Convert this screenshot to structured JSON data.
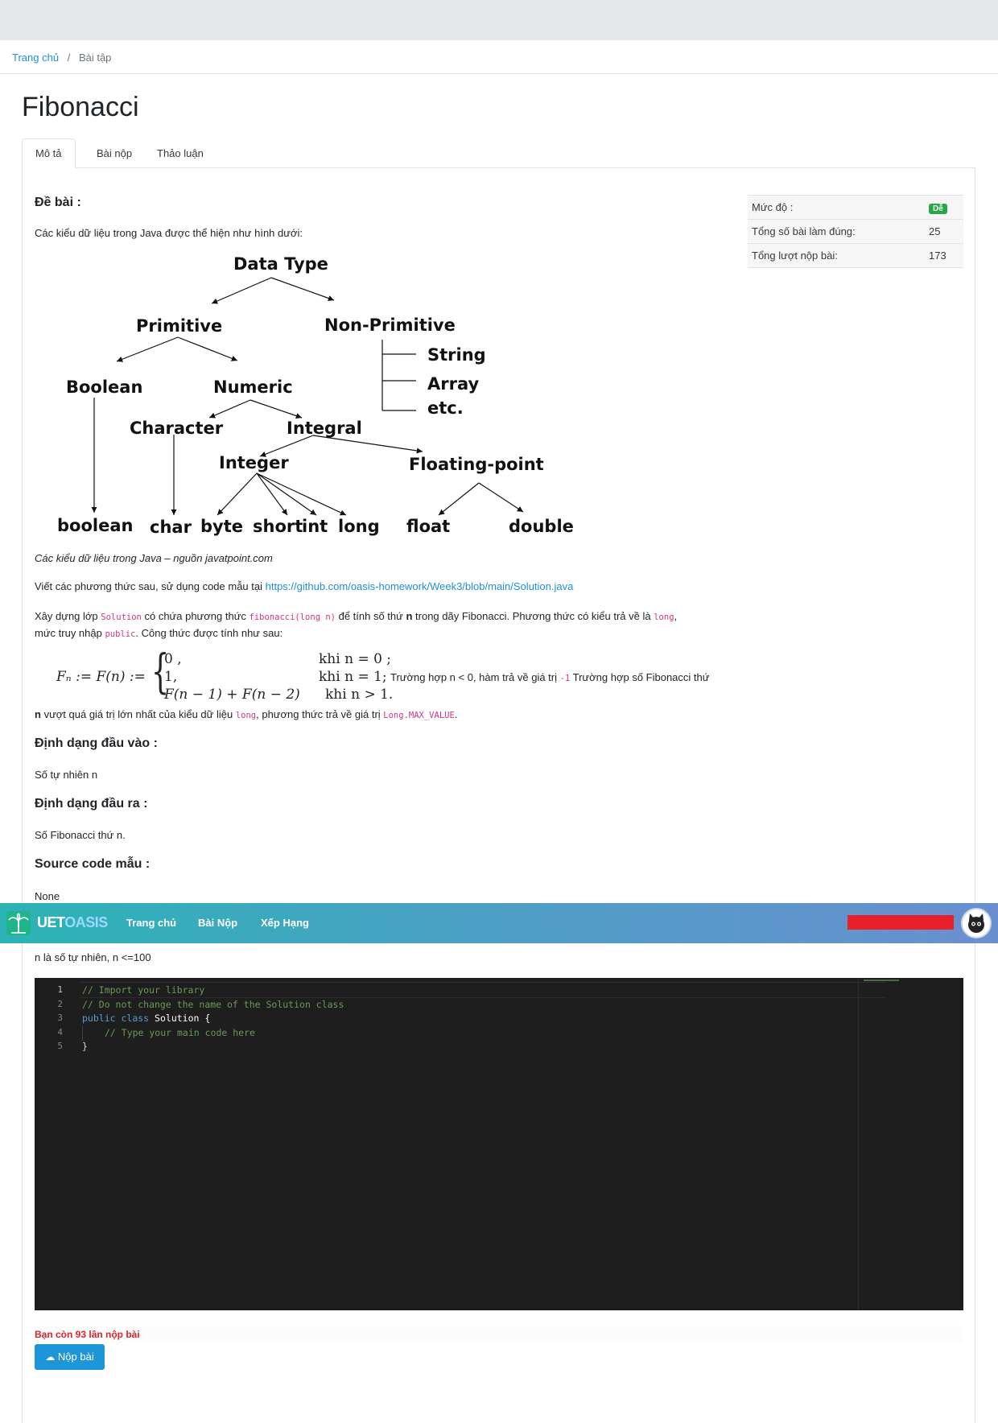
{
  "breadcrumb": {
    "home": "Trang chủ",
    "separator": "/",
    "current": "Bài tập"
  },
  "page_title": "Fibonacci",
  "tabs": [
    {
      "label": "Mô tả",
      "active": true
    },
    {
      "label": "Bài nộp",
      "active": false
    },
    {
      "label": "Thảo luận",
      "active": false
    }
  ],
  "info": {
    "level_label": "Mức độ :",
    "level_value": "Dễ",
    "correct_label": "Tổng số bài làm đúng:",
    "correct_value": "25",
    "submissions_label": "Tổng lượt nộp bài:",
    "submissions_value": "173"
  },
  "problem": {
    "heading": "Đề bài :",
    "intro": "Các kiểu dữ liệu trong Java được thể hiện như hình dưới:",
    "caption": "Các kiểu dữ liệu trong Java – nguồn javatpoint.com",
    "sample_prefix": "Viết các phương thức sau, sử dụng code mẫu tại ",
    "sample_link": "https://github.com/oasis-homework/Week3/blob/main/Solution.java",
    "p1_a": "Xây dựng lớp ",
    "p1_code1": "Solution",
    "p1_b": " có chứa phương thức ",
    "p1_code2": "fibonacci(long n)",
    "p1_c": " để tính số thứ ",
    "p1_bold": "n",
    "p1_d": " trong dãy Fibonacci. Phương thức có kiểu trả về là ",
    "p1_code3": "long",
    "p1_e": ",",
    "p2_a": "mức truy nhập ",
    "p2_code": "public",
    "p2_b": ". Công thức được tính như sau:",
    "formula": {
      "lhs": "Fₙ := F(n) :=",
      "case1": "0 ,",
      "cond1": "khi n = 0 ;",
      "case2": "1,",
      "cond2": "khi n = 1;",
      "case3": "F(n − 1) + F(n − 2)",
      "cond3": "khi n > 1."
    },
    "note_a": "Trường hợp n < 0, hàm trả về giá trị ",
    "note_code": "-1",
    "note_b": " Trường hợp số Fibonacci thứ",
    "p3_bold": "n",
    "p3_a": " vượt quá giá trị lớn nhất của kiểu dữ liệu ",
    "p3_code1": "long",
    "p3_b": ", phương thức trả về giá trị ",
    "p3_code2": "Long.MAX_VALUE",
    "p3_c": "."
  },
  "diagram": {
    "root": "Data Type",
    "primitive": "Primitive",
    "non_primitive": "Non-Primitive",
    "boolean_cat": "Boolean",
    "numeric": "Numeric",
    "string": "String",
    "array": "Array",
    "etc": "etc.",
    "character": "Character",
    "integral": "Integral",
    "integer": "Integer",
    "floating_point": "Floating-point",
    "leaf_boolean": "boolean",
    "leaf_char": "char",
    "leaf_byte": "byte",
    "leaf_short": "short",
    "leaf_int": "int",
    "leaf_long": "long",
    "leaf_float": "float",
    "leaf_double": "double"
  },
  "input_format": {
    "heading": "Định dạng đầu vào :",
    "text": "Số tự nhiên n"
  },
  "output_format": {
    "heading": "Định dạng đầu ra :",
    "text": "Số Fibonacci thứ n."
  },
  "source_code": {
    "heading": "Source code mẫu :",
    "text": "None"
  },
  "constraint": "n là số tự nhiên, n <=100",
  "navbar": {
    "brand_part1": "UET",
    "brand_part2": "OASIS",
    "links": [
      "Trang chủ",
      "Bài Nộp",
      "Xếp Hạng"
    ]
  },
  "editor": {
    "line_numbers": [
      "1",
      "2",
      "3",
      "4",
      "5"
    ],
    "line1": "// Import your library",
    "line2": "// Do not change the name of the Solution class",
    "line3_kw1": "public",
    "line3_kw2": "class",
    "line3_name": "Solution {",
    "line4": "// Type your main code here",
    "line5": "}"
  },
  "remaining_text": "Bạn còn 93 lần nộp bài",
  "submit_label": "Nộp bài",
  "colors": {
    "accent": "#1e95d8",
    "navbar_start": "#2bb3b5",
    "navbar_end": "#6a8fd0",
    "warning": "#d9262c",
    "easy_badge": "#28a745"
  }
}
